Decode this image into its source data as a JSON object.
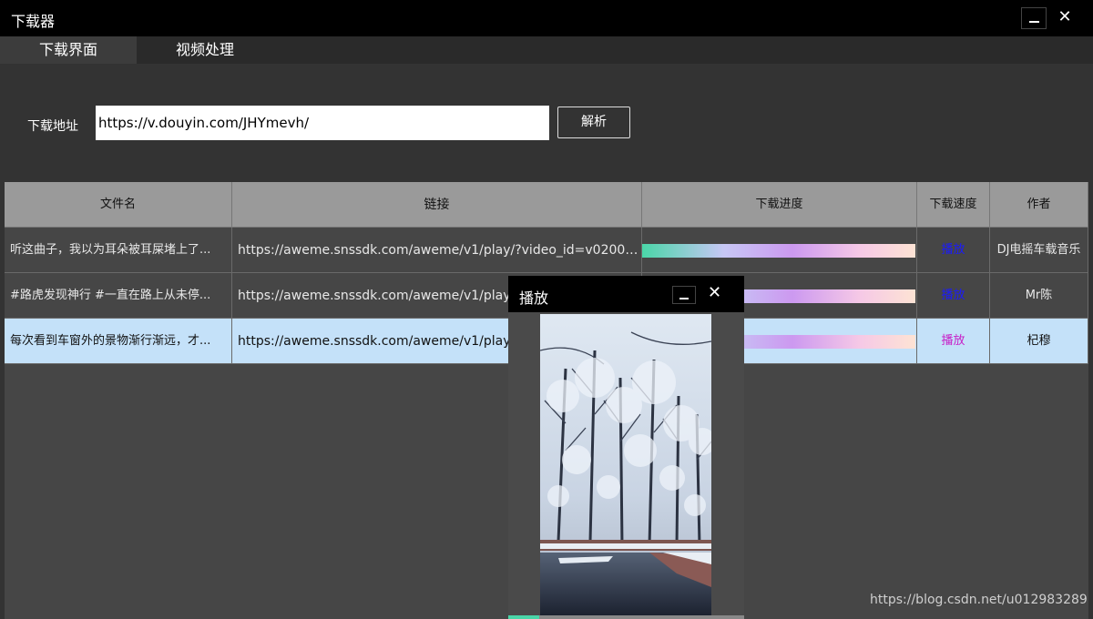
{
  "window": {
    "title": "下载器",
    "minimize_icon": "minimize-icon",
    "close_icon": "close-icon",
    "close_glyph": "✕"
  },
  "tabs": [
    {
      "label": "下载界面"
    },
    {
      "label": "视频处理"
    }
  ],
  "form": {
    "url_label": "下载地址",
    "url_value": "https://v.douyin.com/JHYmevh/",
    "parse_button": "解析"
  },
  "table": {
    "headers": [
      "文件名",
      "链接",
      "下载进度",
      "下载速度",
      "作者"
    ],
    "rows": [
      {
        "name": "听这曲子，我以为耳朵被耳屎堵上了...",
        "link": "https://aweme.snssdk.com/aweme/v1/play/?video_id=v0200f77...",
        "progress": 100,
        "speed": "播放",
        "author": "DJ电摇车载音乐"
      },
      {
        "name": "#路虎发现神行 #一直在路上从未停...",
        "link": "https://aweme.snssdk.com/aweme/v1/play/?",
        "progress": 100,
        "speed": "播放",
        "author": "Mr陈"
      },
      {
        "name": "每次看到车窗外的景物渐行渐远，才...",
        "link": "https://aweme.snssdk.com/aweme/v1/play/?",
        "progress": 100,
        "speed": "播放",
        "author": "杞穆"
      }
    ]
  },
  "player": {
    "title": "播放",
    "close_glyph": "✕",
    "progress": 0.13
  },
  "watermark": "https://blog.csdn.net/u012983289",
  "colors": {
    "accent": "#4ad6a8",
    "selected_row": "#c4e1f9",
    "play_link": "#1a1aff",
    "play_link_selected": "#c71ec7"
  }
}
